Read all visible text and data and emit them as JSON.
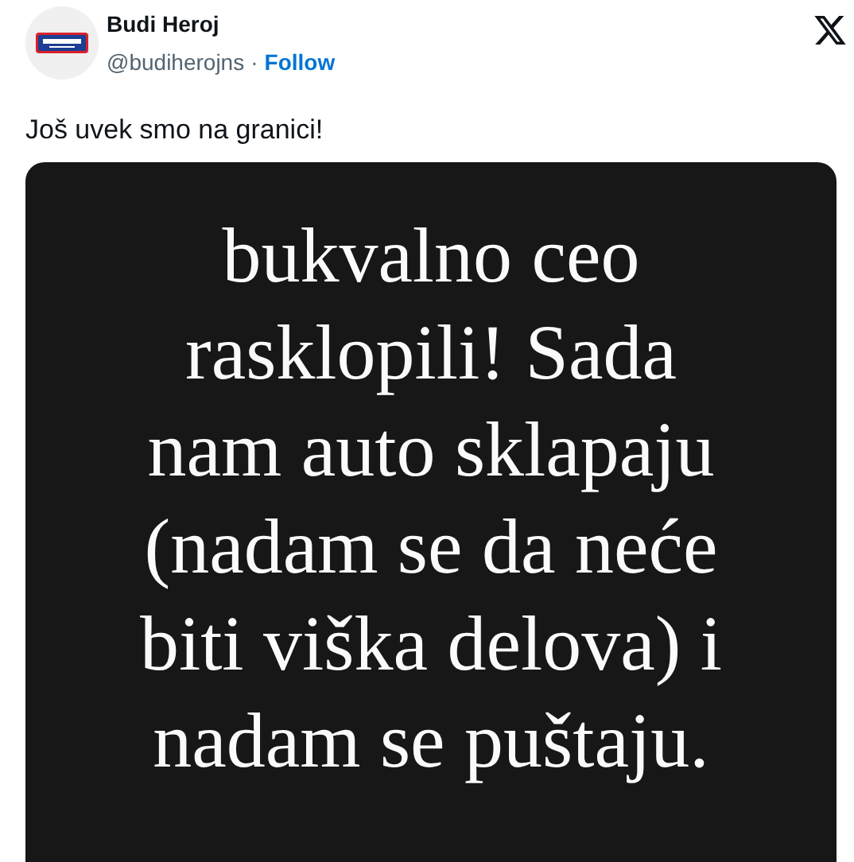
{
  "author": {
    "name": "Budi Heroj",
    "handle": "@budiherojns",
    "separator": "·",
    "follow": "Follow"
  },
  "tweet_text": "Još uvek smo na granici!",
  "media": {
    "lines": [
      "bukvalno ceo",
      "rasklopili! Sada",
      "nam auto sklapaju",
      "(nadam se da neće",
      "biti viška delova) i",
      "nadam se puštaju."
    ]
  }
}
